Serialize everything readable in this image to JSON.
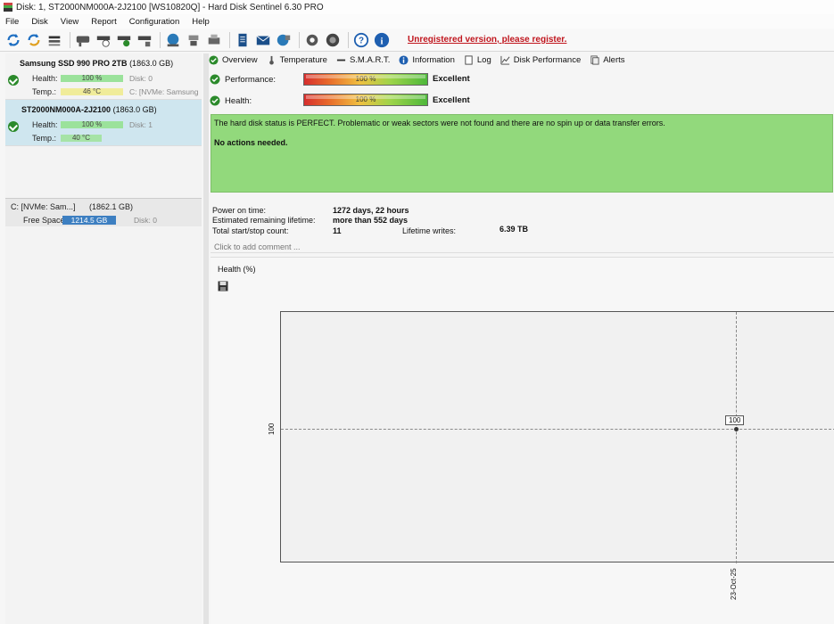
{
  "window": {
    "title": "Disk: 1, ST2000NM000A-2J2100 [WS10820Q]  -  Hard Disk Sentinel 6.30 PRO"
  },
  "menu": [
    "File",
    "Disk",
    "View",
    "Report",
    "Configuration",
    "Help"
  ],
  "toolbar": {
    "icons": [
      "refresh-icon",
      "refresh-all-icon",
      "disk-list-icon",
      "disk-icon",
      "disk-clock-icon",
      "disk-check-icon",
      "disk-gear-icon",
      "network-icon",
      "tools-icon",
      "printer-icon",
      "report-icon",
      "mail-icon",
      "globe-icon",
      "settings-icon",
      "update-icon",
      "help-icon",
      "info-icon"
    ],
    "unregistered": "Unregistered version, please register."
  },
  "disks": [
    {
      "name": "Samsung SSD 990 PRO 2TB",
      "size": "(1863.0 GB)",
      "health_label": "Health:",
      "health": "100 %",
      "health_value": 100,
      "disk_num": "Disk: 0",
      "temp_label": "Temp.:",
      "temp": "46 °C",
      "partition": "C: [NVMe: Samsung"
    },
    {
      "name": "ST2000NM000A-2J2100",
      "size": "(1863.0 GB)",
      "health_label": "Health:",
      "health": "100 %",
      "health_value": 100,
      "disk_num": "Disk: 1",
      "temp_label": "Temp.:",
      "temp": "40 °C"
    }
  ],
  "volume": {
    "name": "C: [NVMe: Sam...]",
    "size": "(1862.1 GB)",
    "free_label": "Free Space",
    "free": "1214.5 GB",
    "disk_num": "Disk: 0"
  },
  "tabs": [
    "Overview",
    "Temperature",
    "S.M.A.R.T.",
    "Information",
    "Log",
    "Disk Performance",
    "Alerts"
  ],
  "metrics": {
    "performance_label": "Performance:",
    "performance": "100 %",
    "performance_rating": "Excellent",
    "health_label": "Health:",
    "health": "100 %",
    "health_rating": "Excellent"
  },
  "status": {
    "line1": "The hard disk status is PERFECT. Problematic or weak sectors were not found and there are no spin up or data transfer errors.",
    "line2": "No actions needed."
  },
  "info": {
    "power_on_label": "Power on time:",
    "power_on": "1272 days, 22 hours",
    "lifetime_label": "Estimated remaining lifetime:",
    "lifetime": "more than 552 days",
    "startstop_label": "Total start/stop count:",
    "startstop": "11",
    "writes_label": "Lifetime writes:",
    "writes": "6.39 TB"
  },
  "comment_placeholder": "Click to add comment ...",
  "chart_data": {
    "type": "line",
    "title": "Health (%)",
    "x": [
      "23-Oct-25"
    ],
    "series": [
      {
        "values": [
          100
        ]
      }
    ],
    "ylabel": "",
    "yticks": [
      "100"
    ],
    "data_labels": [
      "100"
    ],
    "grid": true
  }
}
